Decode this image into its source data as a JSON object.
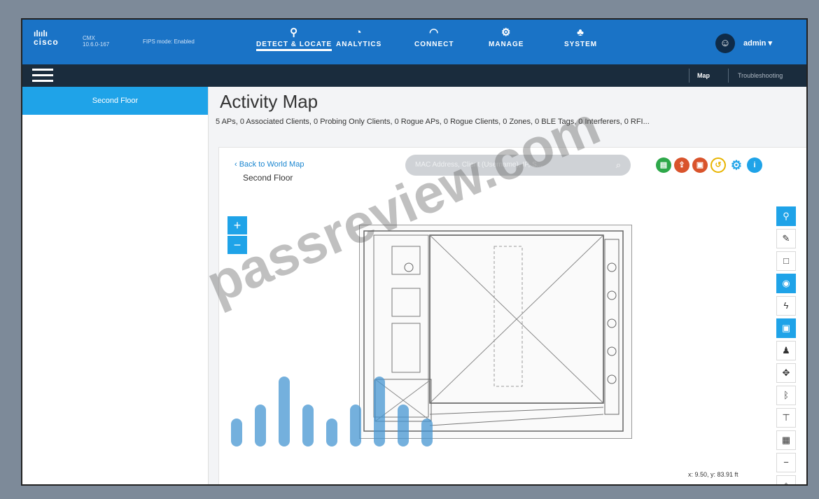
{
  "topnav": {
    "logo": "cisco",
    "product": "CMX",
    "version": "10.6.0-167",
    "fips": "FIPS mode: Enabled",
    "items": [
      {
        "label": "DETECT & LOCATE",
        "icon": "location-pin-icon",
        "active": true
      },
      {
        "label": "ANALYTICS",
        "icon": "dashboard-icon",
        "active": false
      },
      {
        "label": "CONNECT",
        "icon": "wifi-icon",
        "active": false
      },
      {
        "label": "MANAGE",
        "icon": "gears-icon",
        "active": false
      },
      {
        "label": "SYSTEM",
        "icon": "hierarchy-icon",
        "active": false
      }
    ],
    "user": "admin ▾"
  },
  "subnav": {
    "links": [
      "Map",
      "Troubleshooting"
    ]
  },
  "sidebar": {
    "items": [
      {
        "label": "Second Floor",
        "selected": true
      }
    ]
  },
  "main": {
    "title": "Activity Map",
    "summary": "5 APs, 0 Associated Clients, 0 Probing Only Clients, 0 Rogue APs, 0 Rogue Clients, 0 Zones, 0 BLE Tags, 0 Interferers, 0 RFI..."
  },
  "panel": {
    "back": "‹ Back to World Map",
    "floor": "Second Floor",
    "search_placeholder": "MAC Address, Client (Username), IP, S...",
    "coords": "x: 9.50, y: 83.91 ft",
    "zoom_in": "+",
    "zoom_out": "−"
  },
  "colors": {
    "header": "#1a73c6",
    "subnav": "#1a2c3d",
    "accent": "#1fa3e8"
  },
  "watermark": "passreview.com",
  "overlay_logo": "CISCO"
}
